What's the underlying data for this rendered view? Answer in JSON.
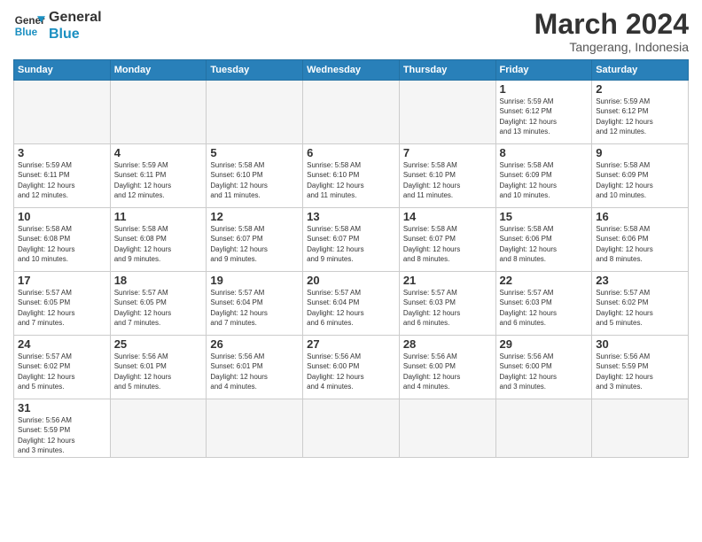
{
  "logo": {
    "line1": "General",
    "line2": "Blue"
  },
  "title": "March 2024",
  "subtitle": "Tangerang, Indonesia",
  "days_of_week": [
    "Sunday",
    "Monday",
    "Tuesday",
    "Wednesday",
    "Thursday",
    "Friday",
    "Saturday"
  ],
  "weeks": [
    [
      {
        "day": "",
        "info": ""
      },
      {
        "day": "",
        "info": ""
      },
      {
        "day": "",
        "info": ""
      },
      {
        "day": "",
        "info": ""
      },
      {
        "day": "",
        "info": ""
      },
      {
        "day": "1",
        "info": "Sunrise: 5:59 AM\nSunset: 6:12 PM\nDaylight: 12 hours\nand 13 minutes."
      },
      {
        "day": "2",
        "info": "Sunrise: 5:59 AM\nSunset: 6:12 PM\nDaylight: 12 hours\nand 12 minutes."
      }
    ],
    [
      {
        "day": "3",
        "info": "Sunrise: 5:59 AM\nSunset: 6:11 PM\nDaylight: 12 hours\nand 12 minutes."
      },
      {
        "day": "4",
        "info": "Sunrise: 5:59 AM\nSunset: 6:11 PM\nDaylight: 12 hours\nand 12 minutes."
      },
      {
        "day": "5",
        "info": "Sunrise: 5:58 AM\nSunset: 6:10 PM\nDaylight: 12 hours\nand 11 minutes."
      },
      {
        "day": "6",
        "info": "Sunrise: 5:58 AM\nSunset: 6:10 PM\nDaylight: 12 hours\nand 11 minutes."
      },
      {
        "day": "7",
        "info": "Sunrise: 5:58 AM\nSunset: 6:10 PM\nDaylight: 12 hours\nand 11 minutes."
      },
      {
        "day": "8",
        "info": "Sunrise: 5:58 AM\nSunset: 6:09 PM\nDaylight: 12 hours\nand 10 minutes."
      },
      {
        "day": "9",
        "info": "Sunrise: 5:58 AM\nSunset: 6:09 PM\nDaylight: 12 hours\nand 10 minutes."
      }
    ],
    [
      {
        "day": "10",
        "info": "Sunrise: 5:58 AM\nSunset: 6:08 PM\nDaylight: 12 hours\nand 10 minutes."
      },
      {
        "day": "11",
        "info": "Sunrise: 5:58 AM\nSunset: 6:08 PM\nDaylight: 12 hours\nand 9 minutes."
      },
      {
        "day": "12",
        "info": "Sunrise: 5:58 AM\nSunset: 6:07 PM\nDaylight: 12 hours\nand 9 minutes."
      },
      {
        "day": "13",
        "info": "Sunrise: 5:58 AM\nSunset: 6:07 PM\nDaylight: 12 hours\nand 9 minutes."
      },
      {
        "day": "14",
        "info": "Sunrise: 5:58 AM\nSunset: 6:07 PM\nDaylight: 12 hours\nand 8 minutes."
      },
      {
        "day": "15",
        "info": "Sunrise: 5:58 AM\nSunset: 6:06 PM\nDaylight: 12 hours\nand 8 minutes."
      },
      {
        "day": "16",
        "info": "Sunrise: 5:58 AM\nSunset: 6:06 PM\nDaylight: 12 hours\nand 8 minutes."
      }
    ],
    [
      {
        "day": "17",
        "info": "Sunrise: 5:57 AM\nSunset: 6:05 PM\nDaylight: 12 hours\nand 7 minutes."
      },
      {
        "day": "18",
        "info": "Sunrise: 5:57 AM\nSunset: 6:05 PM\nDaylight: 12 hours\nand 7 minutes."
      },
      {
        "day": "19",
        "info": "Sunrise: 5:57 AM\nSunset: 6:04 PM\nDaylight: 12 hours\nand 7 minutes."
      },
      {
        "day": "20",
        "info": "Sunrise: 5:57 AM\nSunset: 6:04 PM\nDaylight: 12 hours\nand 6 minutes."
      },
      {
        "day": "21",
        "info": "Sunrise: 5:57 AM\nSunset: 6:03 PM\nDaylight: 12 hours\nand 6 minutes."
      },
      {
        "day": "22",
        "info": "Sunrise: 5:57 AM\nSunset: 6:03 PM\nDaylight: 12 hours\nand 6 minutes."
      },
      {
        "day": "23",
        "info": "Sunrise: 5:57 AM\nSunset: 6:02 PM\nDaylight: 12 hours\nand 5 minutes."
      }
    ],
    [
      {
        "day": "24",
        "info": "Sunrise: 5:57 AM\nSunset: 6:02 PM\nDaylight: 12 hours\nand 5 minutes."
      },
      {
        "day": "25",
        "info": "Sunrise: 5:56 AM\nSunset: 6:01 PM\nDaylight: 12 hours\nand 5 minutes."
      },
      {
        "day": "26",
        "info": "Sunrise: 5:56 AM\nSunset: 6:01 PM\nDaylight: 12 hours\nand 4 minutes."
      },
      {
        "day": "27",
        "info": "Sunrise: 5:56 AM\nSunset: 6:00 PM\nDaylight: 12 hours\nand 4 minutes."
      },
      {
        "day": "28",
        "info": "Sunrise: 5:56 AM\nSunset: 6:00 PM\nDaylight: 12 hours\nand 4 minutes."
      },
      {
        "day": "29",
        "info": "Sunrise: 5:56 AM\nSunset: 6:00 PM\nDaylight: 12 hours\nand 3 minutes."
      },
      {
        "day": "30",
        "info": "Sunrise: 5:56 AM\nSunset: 5:59 PM\nDaylight: 12 hours\nand 3 minutes."
      }
    ],
    [
      {
        "day": "31",
        "info": "Sunrise: 5:56 AM\nSunset: 5:59 PM\nDaylight: 12 hours\nand 3 minutes."
      },
      {
        "day": "",
        "info": ""
      },
      {
        "day": "",
        "info": ""
      },
      {
        "day": "",
        "info": ""
      },
      {
        "day": "",
        "info": ""
      },
      {
        "day": "",
        "info": ""
      },
      {
        "day": "",
        "info": ""
      }
    ]
  ]
}
